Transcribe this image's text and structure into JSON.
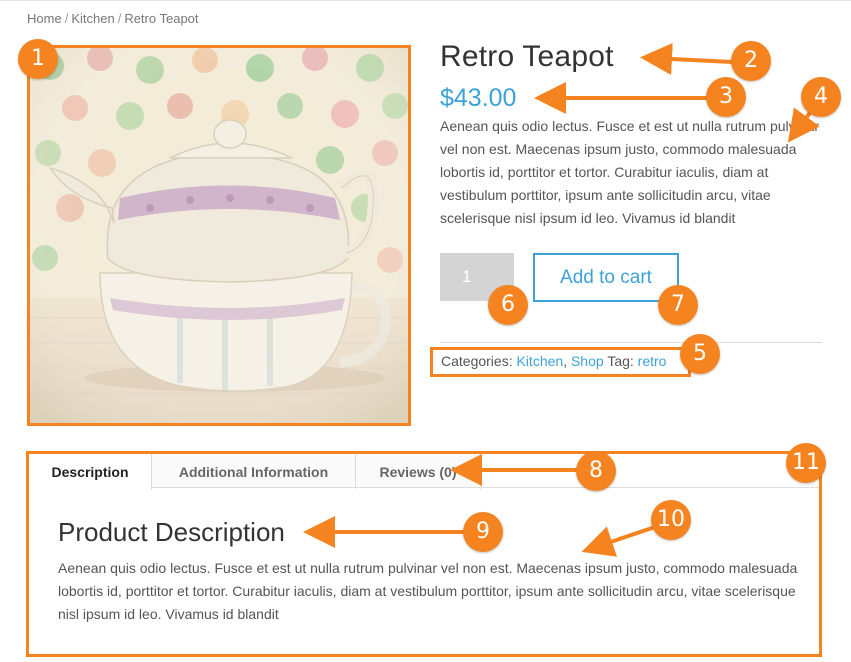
{
  "breadcrumb": {
    "home": "Home",
    "category": "Kitchen",
    "current": "Retro Teapot",
    "separator": "/"
  },
  "product": {
    "title": "Retro Teapot",
    "price": "$43.00",
    "short_description": "Aenean quis odio lectus. Fusce et est ut nulla rutrum pulvinar vel non est. Maecenas ipsum justo, commodo malesuada lobortis id, porttitor et tortor. Curabitur iaculis, diam at vestibulum porttitor, ipsum ante sollicitudin arcu, vitae scelerisque nisl ipsum id leo. Vivamus id blandit",
    "quantity": "1",
    "add_to_cart_label": "Add to cart",
    "image_icon": "teapot-photo"
  },
  "meta": {
    "categories_label": "Categories:",
    "categories": [
      "Kitchen",
      "Shop"
    ],
    "category_separator": ",",
    "tag_label": "Tag:",
    "tag": "retro"
  },
  "tabs": [
    {
      "label": "Description",
      "active": true
    },
    {
      "label": "Additional Information",
      "active": false
    },
    {
      "label": "Reviews (0)",
      "active": false
    }
  ],
  "panel": {
    "title": "Product Description",
    "text": "Aenean quis odio lectus. Fusce et est ut nulla rutrum pulvinar vel non est. Maecenas ipsum justo, commodo malesuada lobortis id, porttitor et tortor. Curabitur iaculis, diam at vestibulum porttitor, ipsum ante sollicitudin arcu, vitae scelerisque nisl ipsum id leo. Vivamus id blandit"
  },
  "annotations": [
    "1",
    "2",
    "3",
    "4",
    "5",
    "6",
    "7",
    "8",
    "9",
    "10",
    "11"
  ],
  "colors": {
    "annotation": "#f5831f",
    "link": "#3da2d8",
    "qty_bg": "#d4d4d4"
  }
}
